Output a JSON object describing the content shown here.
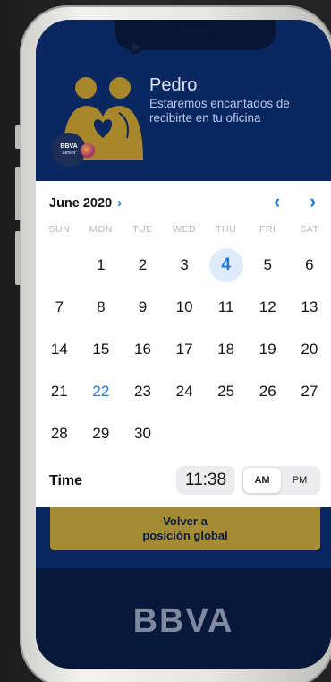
{
  "profile": {
    "name": "Pedro",
    "message": "Estaremos encantados de recibirte en tu oficina",
    "badge_text": "BBVA",
    "badge_subtext": "Senior"
  },
  "calendar": {
    "month_label": "June 2020",
    "weekdays": [
      "SUN",
      "MON",
      "TUE",
      "WED",
      "THU",
      "FRI",
      "SAT"
    ],
    "weeks": [
      [
        "",
        "1",
        "2",
        "3",
        "4",
        "5",
        "6"
      ],
      [
        "7",
        "8",
        "9",
        "10",
        "11",
        "12",
        "13"
      ],
      [
        "14",
        "15",
        "16",
        "17",
        "18",
        "19",
        "20"
      ],
      [
        "21",
        "22",
        "23",
        "24",
        "25",
        "26",
        "27"
      ],
      [
        "28",
        "29",
        "30",
        "",
        "",
        "",
        ""
      ]
    ],
    "selected_day": "4",
    "today_day": "22",
    "time_label": "Time",
    "time_value": "11:38",
    "am_label": "AM",
    "pm_label": "PM",
    "period_selected": "AM"
  },
  "actions": {
    "back_button_line1": "Volver a",
    "back_button_line2": "posición global"
  },
  "footer": {
    "logo_text": "BBVA"
  },
  "colors": {
    "accent": "#1f7ae0",
    "navy": "#0a2760",
    "gold": "#a68b35"
  },
  "icons": {
    "month_chevron": "chevron-right-icon",
    "prev": "chevron-left-icon",
    "next": "chevron-right-icon"
  }
}
